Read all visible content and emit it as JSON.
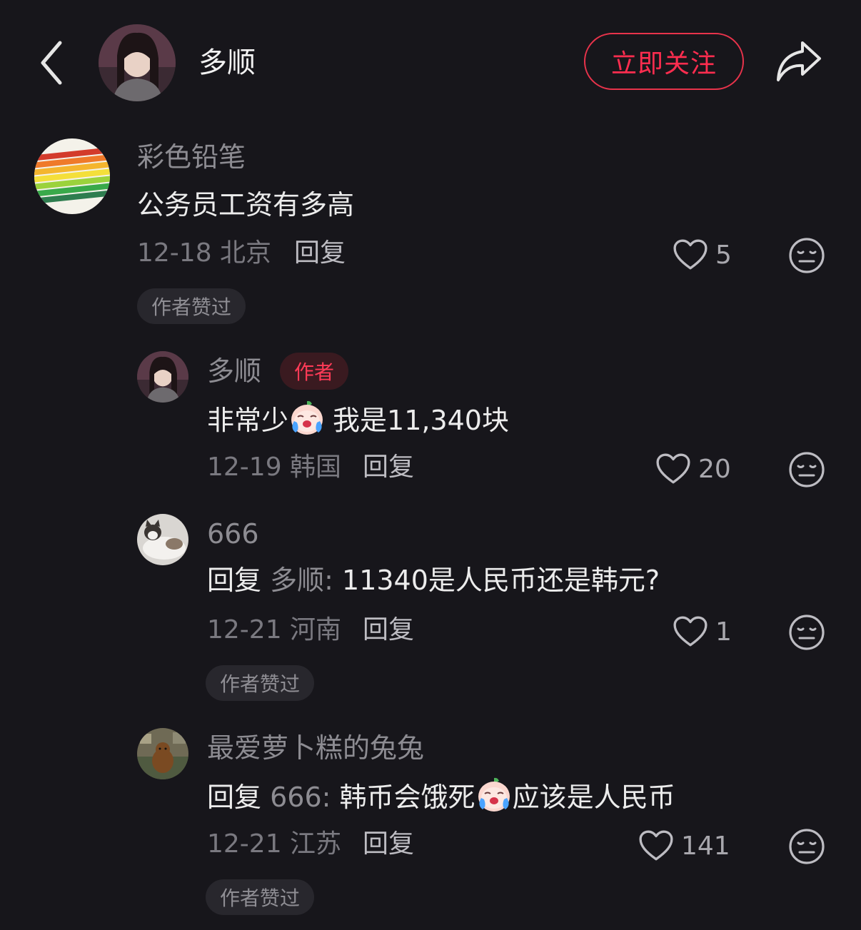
{
  "header": {
    "name": "多顺",
    "follow_label": "立即关注"
  },
  "comments": [
    {
      "user": "彩色铅笔",
      "text": "公务员工资有多高",
      "date_loc": "12-18 北京",
      "reply_label": "回复",
      "likes": "5",
      "badge": "作者赞过"
    },
    {
      "user": "多顺",
      "tag": "作者",
      "text_a": "非常少",
      "text_b": "我是11,340块",
      "date_loc": "12-19 韩国",
      "reply_label": "回复",
      "likes": "20"
    },
    {
      "user": "666",
      "reply_word": "回复",
      "reply_to": "多顺:",
      "text": "11340是人民币还是韩元?",
      "date_loc": "12-21 河南",
      "reply_label": "回复",
      "likes": "1",
      "badge": "作者赞过"
    },
    {
      "user": "最爱萝卜糕的兔兔",
      "reply_word": "回复",
      "reply_to": "666:",
      "text_a": "韩币会饿死",
      "text_b": "应该是人民币",
      "date_loc": "12-21 江苏",
      "reply_label": "回复",
      "likes": "141",
      "badge": "作者赞过"
    }
  ],
  "colors": {
    "accent": "#ff2d4f",
    "background": "#17161b"
  }
}
